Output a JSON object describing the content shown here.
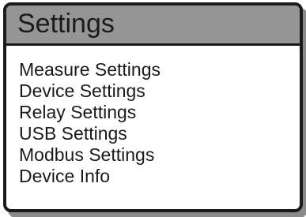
{
  "header": {
    "title": "Settings"
  },
  "menu": {
    "items": [
      {
        "label": "Measure Settings"
      },
      {
        "label": "Device Settings"
      },
      {
        "label": "Relay Settings"
      },
      {
        "label": "USB Settings"
      },
      {
        "label": "Modbus Settings"
      },
      {
        "label": "Device Info"
      }
    ]
  },
  "colors": {
    "title_bar": "#959595",
    "border": "#1a1a1a",
    "shadow": "#8a8a8a",
    "background": "#ffffff"
  }
}
